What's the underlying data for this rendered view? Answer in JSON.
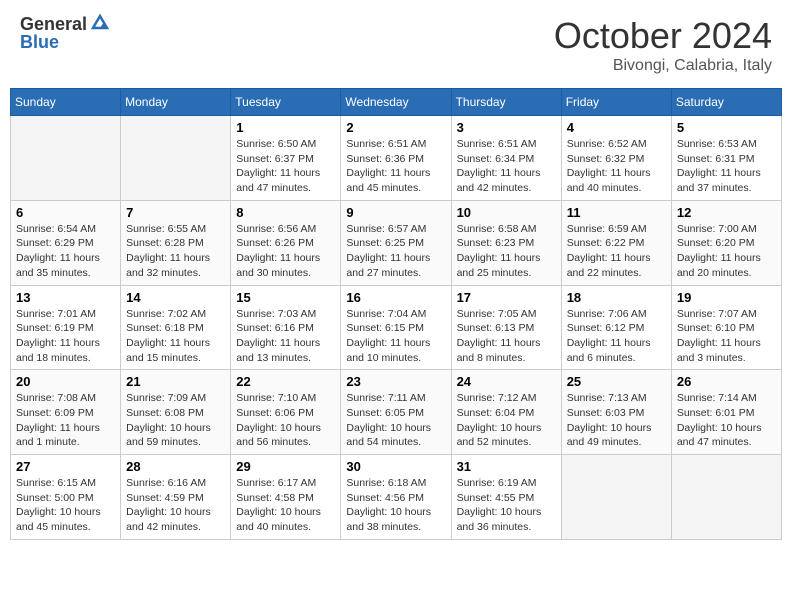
{
  "header": {
    "logo_general": "General",
    "logo_blue": "Blue",
    "month_title": "October 2024",
    "location": "Bivongi, Calabria, Italy"
  },
  "days_of_week": [
    "Sunday",
    "Monday",
    "Tuesday",
    "Wednesday",
    "Thursday",
    "Friday",
    "Saturday"
  ],
  "weeks": [
    [
      {
        "day": "",
        "empty": true
      },
      {
        "day": "",
        "empty": true
      },
      {
        "day": "1",
        "sunrise": "6:50 AM",
        "sunset": "6:37 PM",
        "daylight": "11 hours and 47 minutes."
      },
      {
        "day": "2",
        "sunrise": "6:51 AM",
        "sunset": "6:36 PM",
        "daylight": "11 hours and 45 minutes."
      },
      {
        "day": "3",
        "sunrise": "6:51 AM",
        "sunset": "6:34 PM",
        "daylight": "11 hours and 42 minutes."
      },
      {
        "day": "4",
        "sunrise": "6:52 AM",
        "sunset": "6:32 PM",
        "daylight": "11 hours and 40 minutes."
      },
      {
        "day": "5",
        "sunrise": "6:53 AM",
        "sunset": "6:31 PM",
        "daylight": "11 hours and 37 minutes."
      }
    ],
    [
      {
        "day": "6",
        "sunrise": "6:54 AM",
        "sunset": "6:29 PM",
        "daylight": "11 hours and 35 minutes."
      },
      {
        "day": "7",
        "sunrise": "6:55 AM",
        "sunset": "6:28 PM",
        "daylight": "11 hours and 32 minutes."
      },
      {
        "day": "8",
        "sunrise": "6:56 AM",
        "sunset": "6:26 PM",
        "daylight": "11 hours and 30 minutes."
      },
      {
        "day": "9",
        "sunrise": "6:57 AM",
        "sunset": "6:25 PM",
        "daylight": "11 hours and 27 minutes."
      },
      {
        "day": "10",
        "sunrise": "6:58 AM",
        "sunset": "6:23 PM",
        "daylight": "11 hours and 25 minutes."
      },
      {
        "day": "11",
        "sunrise": "6:59 AM",
        "sunset": "6:22 PM",
        "daylight": "11 hours and 22 minutes."
      },
      {
        "day": "12",
        "sunrise": "7:00 AM",
        "sunset": "6:20 PM",
        "daylight": "11 hours and 20 minutes."
      }
    ],
    [
      {
        "day": "13",
        "sunrise": "7:01 AM",
        "sunset": "6:19 PM",
        "daylight": "11 hours and 18 minutes."
      },
      {
        "day": "14",
        "sunrise": "7:02 AM",
        "sunset": "6:18 PM",
        "daylight": "11 hours and 15 minutes."
      },
      {
        "day": "15",
        "sunrise": "7:03 AM",
        "sunset": "6:16 PM",
        "daylight": "11 hours and 13 minutes."
      },
      {
        "day": "16",
        "sunrise": "7:04 AM",
        "sunset": "6:15 PM",
        "daylight": "11 hours and 10 minutes."
      },
      {
        "day": "17",
        "sunrise": "7:05 AM",
        "sunset": "6:13 PM",
        "daylight": "11 hours and 8 minutes."
      },
      {
        "day": "18",
        "sunrise": "7:06 AM",
        "sunset": "6:12 PM",
        "daylight": "11 hours and 6 minutes."
      },
      {
        "day": "19",
        "sunrise": "7:07 AM",
        "sunset": "6:10 PM",
        "daylight": "11 hours and 3 minutes."
      }
    ],
    [
      {
        "day": "20",
        "sunrise": "7:08 AM",
        "sunset": "6:09 PM",
        "daylight": "11 hours and 1 minute."
      },
      {
        "day": "21",
        "sunrise": "7:09 AM",
        "sunset": "6:08 PM",
        "daylight": "10 hours and 59 minutes."
      },
      {
        "day": "22",
        "sunrise": "7:10 AM",
        "sunset": "6:06 PM",
        "daylight": "10 hours and 56 minutes."
      },
      {
        "day": "23",
        "sunrise": "7:11 AM",
        "sunset": "6:05 PM",
        "daylight": "10 hours and 54 minutes."
      },
      {
        "day": "24",
        "sunrise": "7:12 AM",
        "sunset": "6:04 PM",
        "daylight": "10 hours and 52 minutes."
      },
      {
        "day": "25",
        "sunrise": "7:13 AM",
        "sunset": "6:03 PM",
        "daylight": "10 hours and 49 minutes."
      },
      {
        "day": "26",
        "sunrise": "7:14 AM",
        "sunset": "6:01 PM",
        "daylight": "10 hours and 47 minutes."
      }
    ],
    [
      {
        "day": "27",
        "sunrise": "6:15 AM",
        "sunset": "5:00 PM",
        "daylight": "10 hours and 45 minutes."
      },
      {
        "day": "28",
        "sunrise": "6:16 AM",
        "sunset": "4:59 PM",
        "daylight": "10 hours and 42 minutes."
      },
      {
        "day": "29",
        "sunrise": "6:17 AM",
        "sunset": "4:58 PM",
        "daylight": "10 hours and 40 minutes."
      },
      {
        "day": "30",
        "sunrise": "6:18 AM",
        "sunset": "4:56 PM",
        "daylight": "10 hours and 38 minutes."
      },
      {
        "day": "31",
        "sunrise": "6:19 AM",
        "sunset": "4:55 PM",
        "daylight": "10 hours and 36 minutes."
      },
      {
        "day": "",
        "empty": true
      },
      {
        "day": "",
        "empty": true
      }
    ]
  ],
  "labels": {
    "sunrise": "Sunrise:",
    "sunset": "Sunset:",
    "daylight": "Daylight:"
  }
}
